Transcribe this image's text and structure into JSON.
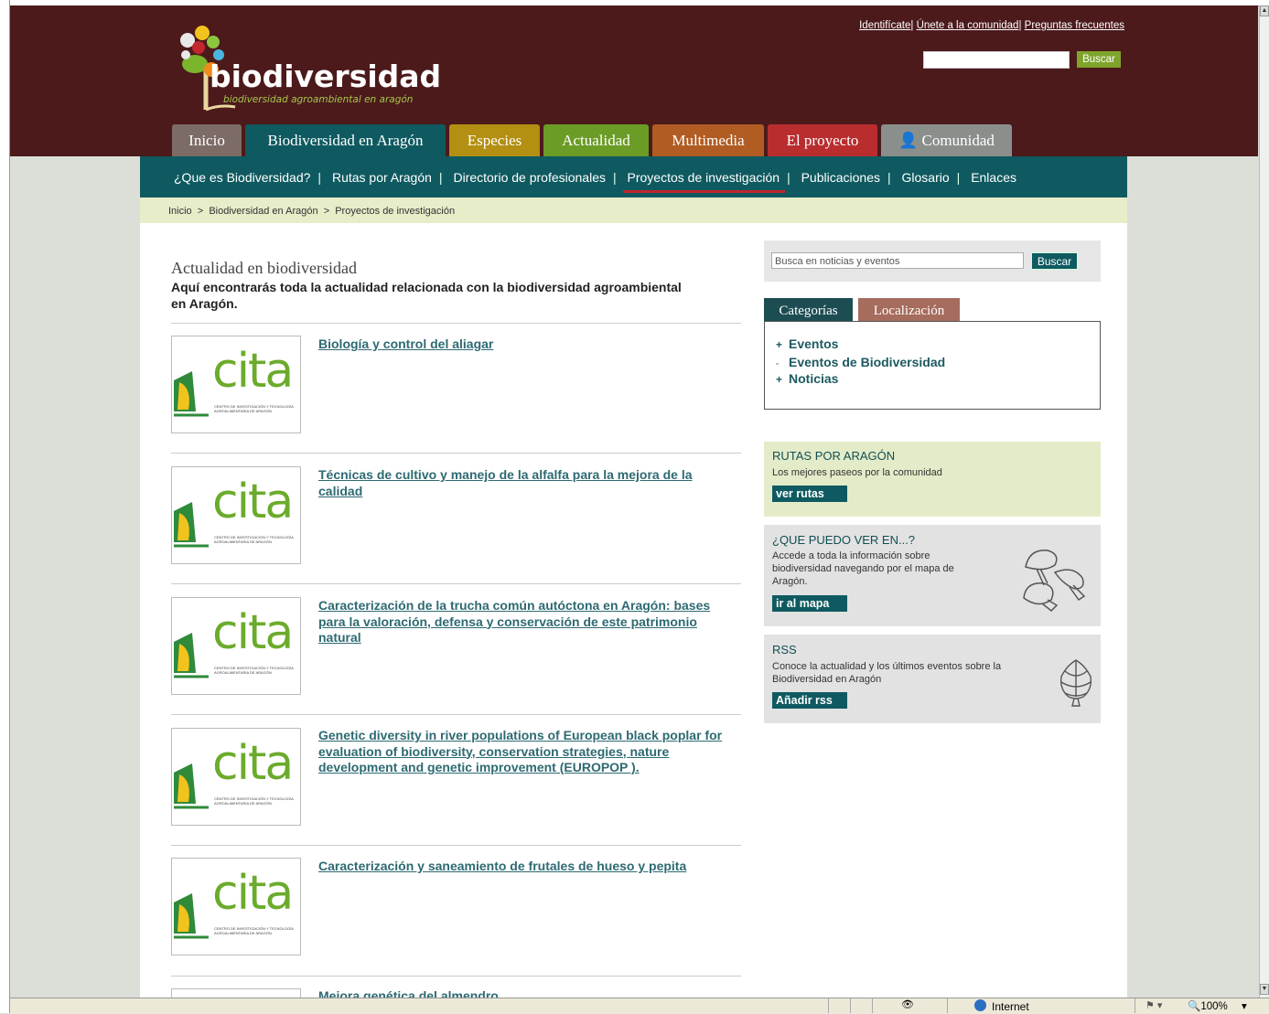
{
  "header": {
    "logo_text": "biodiversidad",
    "logo_sub": "biodiversidad agroambiental en aragón",
    "top_links": [
      "Identifícate",
      "Únete a la comunidad",
      "Preguntas frecuentes"
    ],
    "search_button": "Buscar"
  },
  "main_tabs": [
    {
      "label": "Inicio",
      "color": "#7d6b66"
    },
    {
      "label": "Biodiversidad en Aragón",
      "color": "#0f5a60"
    },
    {
      "label": "Especies",
      "color": "#b38f12"
    },
    {
      "label": "Actualidad",
      "color": "#6b9c26"
    },
    {
      "label": "Multimedia",
      "color": "#b05c23"
    },
    {
      "label": "El proyecto",
      "color": "#b92d2f"
    },
    {
      "label": "Comunidad",
      "color": "#8a8f8c"
    }
  ],
  "subnav": [
    "¿Que es Biodiversidad?",
    "Rutas por Aragón",
    "Directorio de profesionales",
    "Proyectos de investigación",
    "Publicaciones",
    "Glosario",
    "Enlaces"
  ],
  "breadcrumb": "Inicio  >  Biodiversidad en Aragón  >  Proyectos de investigación",
  "content": {
    "title": "Actualidad en biodiversidad",
    "description": "Aquí encontrarás toda la actualidad relacionada con la biodiversidad agroambiental en Aragón.",
    "thumb_text": "cita",
    "thumb_caption_1": "CENTRO DE INVESTIGACIÓN Y TECNOLOGÍA",
    "thumb_caption_2": "AGROALIMENTARIA DE ARAGÓN",
    "items": [
      "Biología y control del aliagar",
      "Técnicas de cultivo y manejo de la alfalfa para la mejora de la calidad",
      "Caracterización de la trucha común autóctona en Aragón: bases para la valoración, defensa y conservación de este patrimonio natural",
      "Genetic diversity in river populations of European black poplar for evaluation of biodiversity, conservation strategies, nature development and genetic improvement (EUROPOP ).",
      "Caracterización y saneamiento de frutales de hueso y pepita",
      "Mejora genética del almendro"
    ]
  },
  "sidebar": {
    "search_placeholder": "Busca en noticias y eventos",
    "search_button": "Buscar",
    "tabs": [
      "Categorías",
      "Localización"
    ],
    "categories": [
      "Eventos",
      "Eventos de Biodiversidad",
      "Noticias"
    ],
    "promos": [
      {
        "title": "RUTAS POR ARAGÓN",
        "text": "Los mejores paseos por la comunidad",
        "button": "ver rutas"
      },
      {
        "title": "¿QUE PUEDO VER EN...?",
        "text": "Accede a toda la información sobre biodiversidad navegando por el mapa de Aragón.",
        "button": "ir al mapa"
      },
      {
        "title": "RSS",
        "text": "Conoce la actualidad y los últimos eventos sobre la Biodiversidad en Aragón",
        "button": "Añadir rss"
      }
    ]
  },
  "statusbar": {
    "zone": "Internet",
    "zoom": "100%"
  }
}
